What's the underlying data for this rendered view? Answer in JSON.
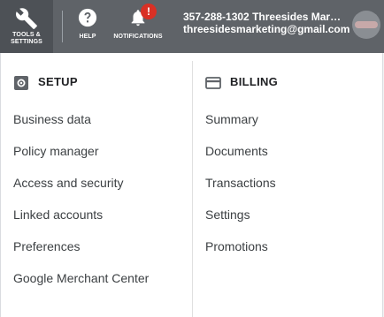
{
  "topbar": {
    "tools": {
      "label_line1": "TOOLS &",
      "label_line2": "SETTINGS",
      "icon": "wrench-icon"
    },
    "help": {
      "label": "HELP",
      "icon": "help-circle-icon"
    },
    "notifications": {
      "label": "NOTIFICATIONS",
      "icon": "bell-icon",
      "badge": "!"
    },
    "account": {
      "phone_name": "357-288-1302 Threesides Marke...",
      "email": "threesidesmarketing@gmail.com"
    },
    "avatar": "avatar"
  },
  "setup": {
    "title": "SETUP",
    "icon": "gear-icon",
    "items": [
      "Business data",
      "Policy manager",
      "Access and security",
      "Linked accounts",
      "Preferences",
      "Google Merchant Center"
    ]
  },
  "billing": {
    "title": "BILLING",
    "icon": "credit-card-icon",
    "items": [
      "Summary",
      "Documents",
      "Transactions",
      "Settings",
      "Promotions"
    ]
  },
  "colors": {
    "topbar": "#5f6368",
    "tools_tab": "#4d5156",
    "badge": "#d93025",
    "text": "#3c4043"
  }
}
